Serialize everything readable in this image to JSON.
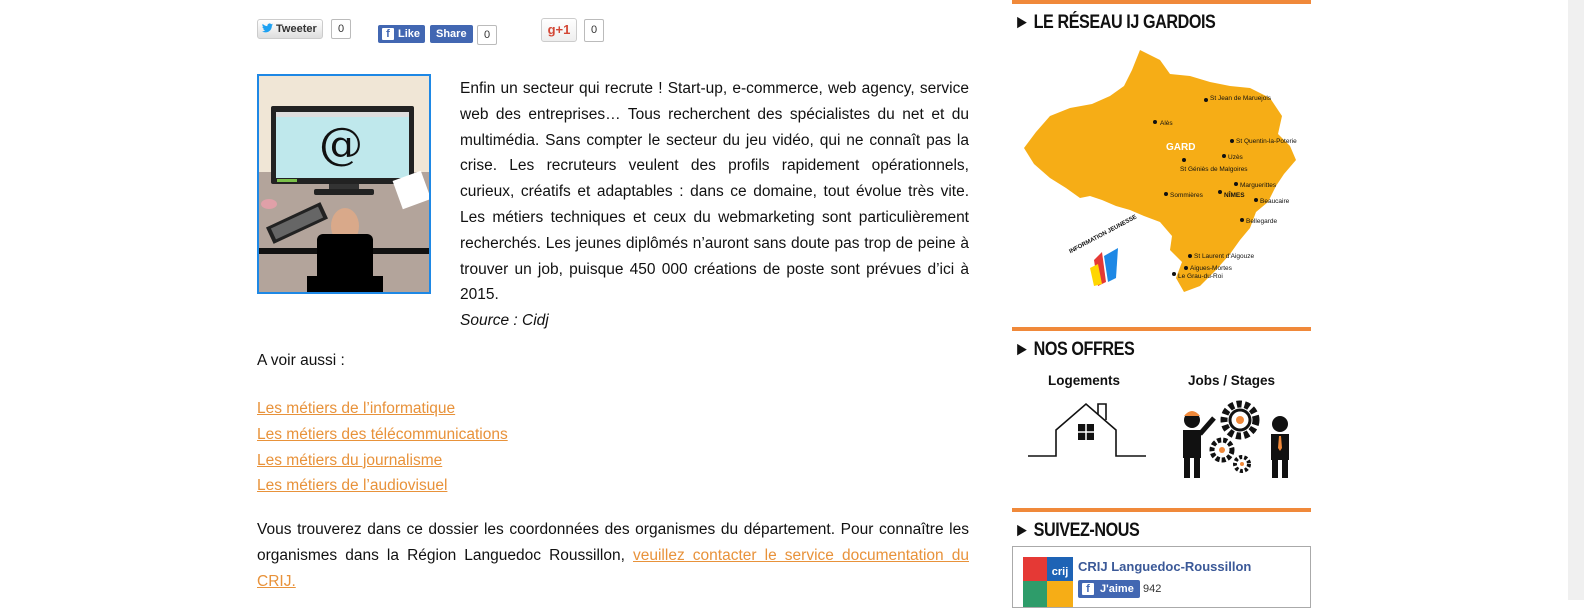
{
  "social": {
    "tweet_label": "Tweeter",
    "tweet_count": "0",
    "fb_like_label": "Like",
    "fb_share_label": "Share",
    "fb_count": "0",
    "gplus_label": "g+1",
    "gplus_count": "0"
  },
  "article": {
    "paragraph": "Enfin un secteur qui recrute ! Start-up, e-commerce, web agency, service web des entreprises… Tous recherchent des spécialistes du net et du multimédia. Sans compter le secteur du jeu vidéo, qui ne connaît pas la crise. Les recruteurs veulent des profils rapidement opérationnels, curieux, créatifs et adaptables : dans ce domaine, tout évolue très vite. Les métiers techniques et ceux du webmarketing sont particulièrement recherchés. Les jeunes diplômés n’auront sans doute pas trop de peine à trouver un job, puisque 450 000 créations de poste sont prévues d’ici à 2015.",
    "source": "Source : Cidj",
    "thumb_symbol": "@",
    "see_also": "A voir aussi :",
    "links": [
      "Les métiers de l’informatique",
      "Les métiers des télécommunications",
      "Les métiers du journalisme",
      "Les métiers de l’audiovisuel"
    ],
    "bottom_text": "Vous trouverez dans ce dossier les coordonnées des organismes du département. Pour connaître les organismes dans la Région Languedoc Roussillon,",
    "bottom_link": "veuillez contacter le service documentation du CRIJ."
  },
  "sidebar": {
    "reseau_title": "► LE RÉSEAU IJ GARDOIS",
    "map": {
      "region_label": "GARD",
      "towns": [
        "St Jean de Maruejols",
        "Alès",
        "St Quentin-la-Poterie",
        "Uzès",
        "St Géniès de Malgoires",
        "Marguerittes",
        "Sommières",
        "NÎMES",
        "Beaucaire",
        "Bellegarde",
        "St Laurent d'Aigouze",
        "Aigues-Mortes",
        "Le Grau-du-Roi"
      ],
      "logo_text": "INFORMATION JEUNESSE"
    },
    "offres_title": "► NOS OFFRES",
    "offres": [
      {
        "label": "Logements"
      },
      {
        "label": "Jobs / Stages"
      }
    ],
    "suivez_title": "► SUIVEZ-NOUS",
    "fb_widget": {
      "page_name": "CRIJ Languedoc-Roussillon",
      "logo_text": "crij",
      "like_label": "J'aime",
      "like_count": "942"
    }
  },
  "colors": {
    "accent": "#f0893a",
    "link": "#e8923a",
    "map": "#f6ad16",
    "facebook": "#4267b2",
    "thumb_border": "#1e88e5"
  }
}
